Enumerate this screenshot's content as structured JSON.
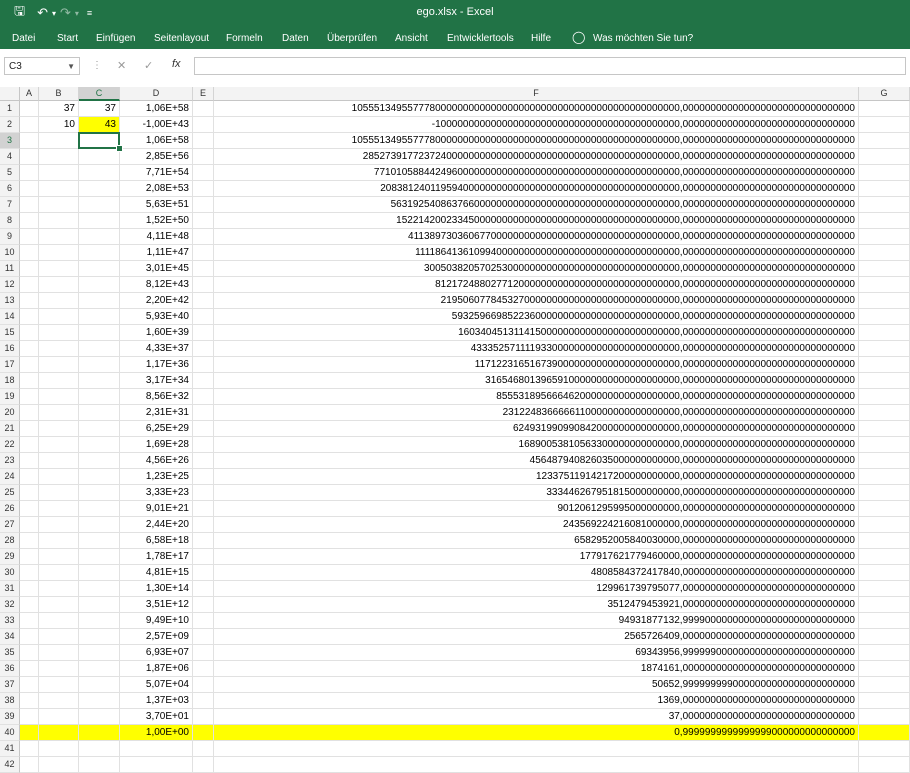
{
  "window": {
    "title": "ego.xlsx  -  Excel"
  },
  "ribbon": {
    "tabs": [
      {
        "label": "Datei"
      },
      {
        "label": "Start"
      },
      {
        "label": "Einfügen"
      },
      {
        "label": "Seitenlayout"
      },
      {
        "label": "Formeln"
      },
      {
        "label": "Daten"
      },
      {
        "label": "Überprüfen"
      },
      {
        "label": "Ansicht"
      },
      {
        "label": "Entwicklertools"
      },
      {
        "label": "Hilfe"
      }
    ],
    "tell_me": "Was möchten Sie tun?"
  },
  "formula_bar": {
    "name_box": "C3",
    "fx_label": "fx",
    "content": ""
  },
  "colors": {
    "accent": "#217346",
    "highlight": "#ffff00"
  },
  "columns": [
    "A",
    "B",
    "C",
    "D",
    "E",
    "F",
    "G"
  ],
  "selected_cell": "C3",
  "rows": [
    {
      "n": "1",
      "B": "37",
      "C": "37",
      "D": "1,06E+58",
      "F": "10555134955777800000000000000000000000000000000000000000000,0000000000000000000000000000000"
    },
    {
      "n": "2",
      "B": "10",
      "C": "43",
      "D": "-1,00E+43",
      "F": "-10000000000000000000000000000000000000000000,0000000000000000000000000000000",
      "C_hl": true
    },
    {
      "n": "3",
      "D": "1,06E+58",
      "F": "10555134955777800000000000000000000000000000000000000000000,0000000000000000000000000000000"
    },
    {
      "n": "4",
      "D": "2,85E+56",
      "F": "285273917723724000000000000000000000000000000000000000000,0000000000000000000000000000000"
    },
    {
      "n": "5",
      "D": "7,71E+54",
      "F": "7710105884424960000000000000000000000000000000000000000,0000000000000000000000000000000"
    },
    {
      "n": "6",
      "D": "2,08E+53",
      "F": "208381240119594000000000000000000000000000000000000000,0000000000000000000000000000000"
    },
    {
      "n": "7",
      "D": "5,63E+51",
      "F": "5631925408637660000000000000000000000000000000000000,0000000000000000000000000000000"
    },
    {
      "n": "8",
      "D": "1,52E+50",
      "F": "152214200233450000000000000000000000000000000000000,0000000000000000000000000000000"
    },
    {
      "n": "9",
      "D": "4,11E+48",
      "F": "4113897303606770000000000000000000000000000000000,0000000000000000000000000000000"
    },
    {
      "n": "10",
      "D": "1,11E+47",
      "F": "111186413610994000000000000000000000000000000000,0000000000000000000000000000000"
    },
    {
      "n": "11",
      "D": "3,01E+45",
      "F": "3005038205702530000000000000000000000000000000,0000000000000000000000000000000"
    },
    {
      "n": "12",
      "D": "8,12E+43",
      "F": "81217248802771200000000000000000000000000000,0000000000000000000000000000000"
    },
    {
      "n": "13",
      "D": "2,20E+42",
      "F": "2195060778453270000000000000000000000000000,0000000000000000000000000000000"
    },
    {
      "n": "14",
      "D": "5,93E+40",
      "F": "59325966985223600000000000000000000000000,0000000000000000000000000000000"
    },
    {
      "n": "15",
      "D": "1,60E+39",
      "F": "1603404513114150000000000000000000000000,0000000000000000000000000000000"
    },
    {
      "n": "16",
      "D": "4,33E+37",
      "F": "43335257111193300000000000000000000000,0000000000000000000000000000000"
    },
    {
      "n": "17",
      "D": "1,17E+36",
      "F": "1171223165167390000000000000000000000,0000000000000000000000000000000"
    },
    {
      "n": "18",
      "D": "3,17E+34",
      "F": "31654680139659100000000000000000000,0000000000000000000000000000000"
    },
    {
      "n": "19",
      "D": "8,56E+32",
      "F": "855531895666462000000000000000000,0000000000000000000000000000000"
    },
    {
      "n": "20",
      "D": "2,31E+31",
      "F": "23122483666661100000000000000000,0000000000000000000000000000000"
    },
    {
      "n": "21",
      "D": "6,25E+29",
      "F": "624931990990842000000000000000,0000000000000000000000000000000"
    },
    {
      "n": "22",
      "D": "1,69E+28",
      "F": "16890053810563300000000000000,0000000000000000000000000000000"
    },
    {
      "n": "23",
      "D": "4,56E+26",
      "F": "456487940826035000000000000,0000000000000000000000000000000"
    },
    {
      "n": "24",
      "D": "1,23E+25",
      "F": "12337511914217200000000000,0000000000000000000000000000000"
    },
    {
      "n": "25",
      "D": "3,33E+23",
      "F": "333446267951815000000000,0000000000000000000000000000000"
    },
    {
      "n": "26",
      "D": "9,01E+21",
      "F": "9012061295995000000000,0000000000000000000000000000000"
    },
    {
      "n": "27",
      "D": "2,44E+20",
      "F": "243569224216081000000,0000000000000000000000000000000"
    },
    {
      "n": "28",
      "D": "6,58E+18",
      "F": "6582952005840030000,0000000000000000000000000000000"
    },
    {
      "n": "29",
      "D": "1,78E+17",
      "F": "177917621779460000,0000000000000000000000000000000"
    },
    {
      "n": "30",
      "D": "4,81E+15",
      "F": "4808584372417840,0000000000000000000000000000000"
    },
    {
      "n": "31",
      "D": "1,30E+14",
      "F": "129961739795077,0000000000000000000000000000000"
    },
    {
      "n": "32",
      "D": "3,51E+12",
      "F": "3512479453921,0000000000000000000000000000000"
    },
    {
      "n": "33",
      "D": "9,49E+10",
      "F": "94931877132,9999000000000000000000000000000"
    },
    {
      "n": "34",
      "D": "2,57E+09",
      "F": "2565726409,0000000000000000000000000000000"
    },
    {
      "n": "35",
      "D": "6,93E+07",
      "F": "69343956,9999990000000000000000000000000"
    },
    {
      "n": "36",
      "D": "1,87E+06",
      "F": "1874161,0000000000000000000000000000000"
    },
    {
      "n": "37",
      "D": "5,07E+04",
      "F": "50652,9999999990000000000000000000000"
    },
    {
      "n": "38",
      "D": "1,37E+03",
      "F": "1369,0000000000000000000000000000000"
    },
    {
      "n": "39",
      "D": "3,70E+01",
      "F": "37,0000000000000000000000000000000"
    },
    {
      "n": "40",
      "D": "1,00E+00",
      "F": "0,9999999999999999000000000000000",
      "row_hl": true
    },
    {
      "n": "41"
    },
    {
      "n": "42"
    }
  ]
}
